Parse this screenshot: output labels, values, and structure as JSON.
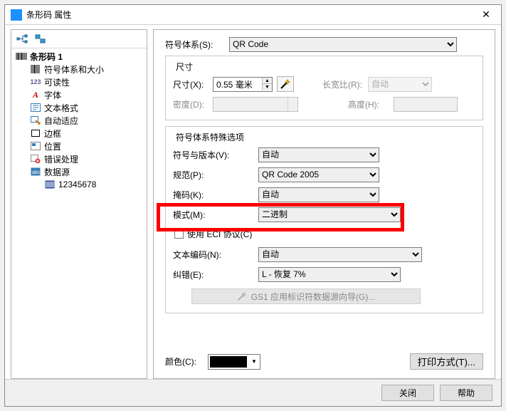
{
  "title": "条形码 属性",
  "tree": {
    "root": "条形码 1",
    "items": [
      "符号体系和大小",
      "可读性",
      "字体",
      "文本格式",
      "自动适应",
      "边框",
      "位置",
      "错误处理",
      "数据源"
    ],
    "data_source_value": "12345678"
  },
  "symbol_system": {
    "label": "符号体系(S):",
    "value": "QR Code"
  },
  "size": {
    "legend": "尺寸",
    "dim_label": "尺寸(X):",
    "dim_value": "0.55 毫米",
    "ratio_label": "长宽比(R):",
    "ratio_value": "自动",
    "density_label": "密度(D):",
    "height_label": "高度(H):"
  },
  "special": {
    "legend": "符号体系特殊选项",
    "version_label": "符号与版本(V):",
    "version_value": "自动",
    "spec_label": "规范(P):",
    "spec_value": "QR Code 2005",
    "mask_label": "掩码(K):",
    "mask_value": "自动",
    "mode_label": "模式(M):",
    "mode_value": "二进制",
    "use_eci_label": "使用 ECI 协议(C)",
    "encoding_label": "文本编码(N):",
    "encoding_value": "自动",
    "ecc_label": "纠错(E):",
    "ecc_value": "L - 恢复 7%",
    "gs1_wizard": "GS1 应用标识符数据源向导(G)..."
  },
  "color_label": "颜色(C):",
  "print_btn": "打印方式(T)...",
  "footer": {
    "close": "关闭",
    "help": "帮助"
  },
  "readability_num": "123"
}
